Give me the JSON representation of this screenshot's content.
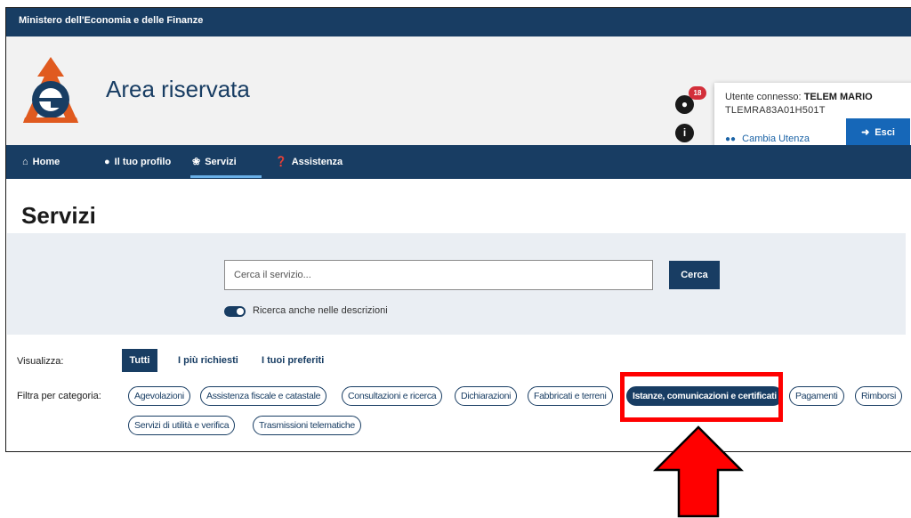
{
  "topbar": {
    "ministry": "Ministero dell'Economia e delle Finanze"
  },
  "header": {
    "title": "Area riservata",
    "notifications_count": "18",
    "user": {
      "label": "Utente connesso:",
      "name": "TELEM MARIO",
      "code": "TLEMRA83A01H501T",
      "switch_label": "Cambia Utenza",
      "exit_label": "Esci"
    }
  },
  "nav": {
    "items": [
      {
        "label": "Home",
        "icon": "home-icon"
      },
      {
        "label": "Il tuo profilo",
        "icon": "user-icon"
      },
      {
        "label": "Servizi",
        "icon": "services-icon",
        "active": true
      },
      {
        "label": "Assistenza",
        "icon": "help-icon"
      }
    ]
  },
  "page": {
    "title": "Servizi"
  },
  "search": {
    "placeholder": "Cerca il servizio...",
    "button_label": "Cerca",
    "toggle_label": "Ricerca anche nelle descrizioni",
    "toggle_on": true
  },
  "view": {
    "label": "Visualizza:",
    "tabs": [
      "Tutti",
      "I più richiesti",
      "I tuoi preferiti"
    ],
    "selected": "Tutti"
  },
  "filter": {
    "label": "Filtra per categoria:",
    "categories": [
      "Agevolazioni",
      "Assistenza fiscale e catastale",
      "Consultazioni e ricerca",
      "Dichiarazioni",
      "Fabbricati e terreni",
      "Istanze, comunicazioni e certificati",
      "Pagamenti",
      "Rimborsi",
      "Servizi di utilità e verifica",
      "Trasmissioni telematiche"
    ],
    "active": "Istanze, comunicazioni e certificati"
  },
  "colors": {
    "brand_dark": "#183d63",
    "button_blue": "#1667b8",
    "badge_red": "#d32f3a",
    "annotation_red": "#ff0000"
  }
}
